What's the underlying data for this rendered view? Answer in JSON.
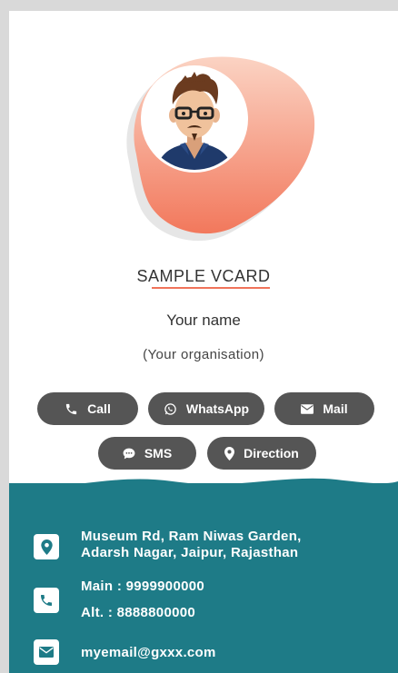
{
  "card": {
    "title": "SAMPLE VCARD",
    "name": "Your name",
    "organisation": "(Your organisation)"
  },
  "actions": {
    "call": "Call",
    "whatsapp": "WhatsApp",
    "mail": "Mail",
    "sms": "SMS",
    "direction": "Direction"
  },
  "contact": {
    "address_line1": "Museum Rd, Ram Niwas Garden,",
    "address_line2": "Adarsh Nagar, Jaipur, Rajasthan",
    "phone_main": "Main : 9999900000",
    "phone_alt": "Alt. : 8888800000",
    "email": "myemail@gxxx.com"
  },
  "colors": {
    "teal": "#1e7b87",
    "button": "#555555",
    "accent": "#f0735a"
  }
}
